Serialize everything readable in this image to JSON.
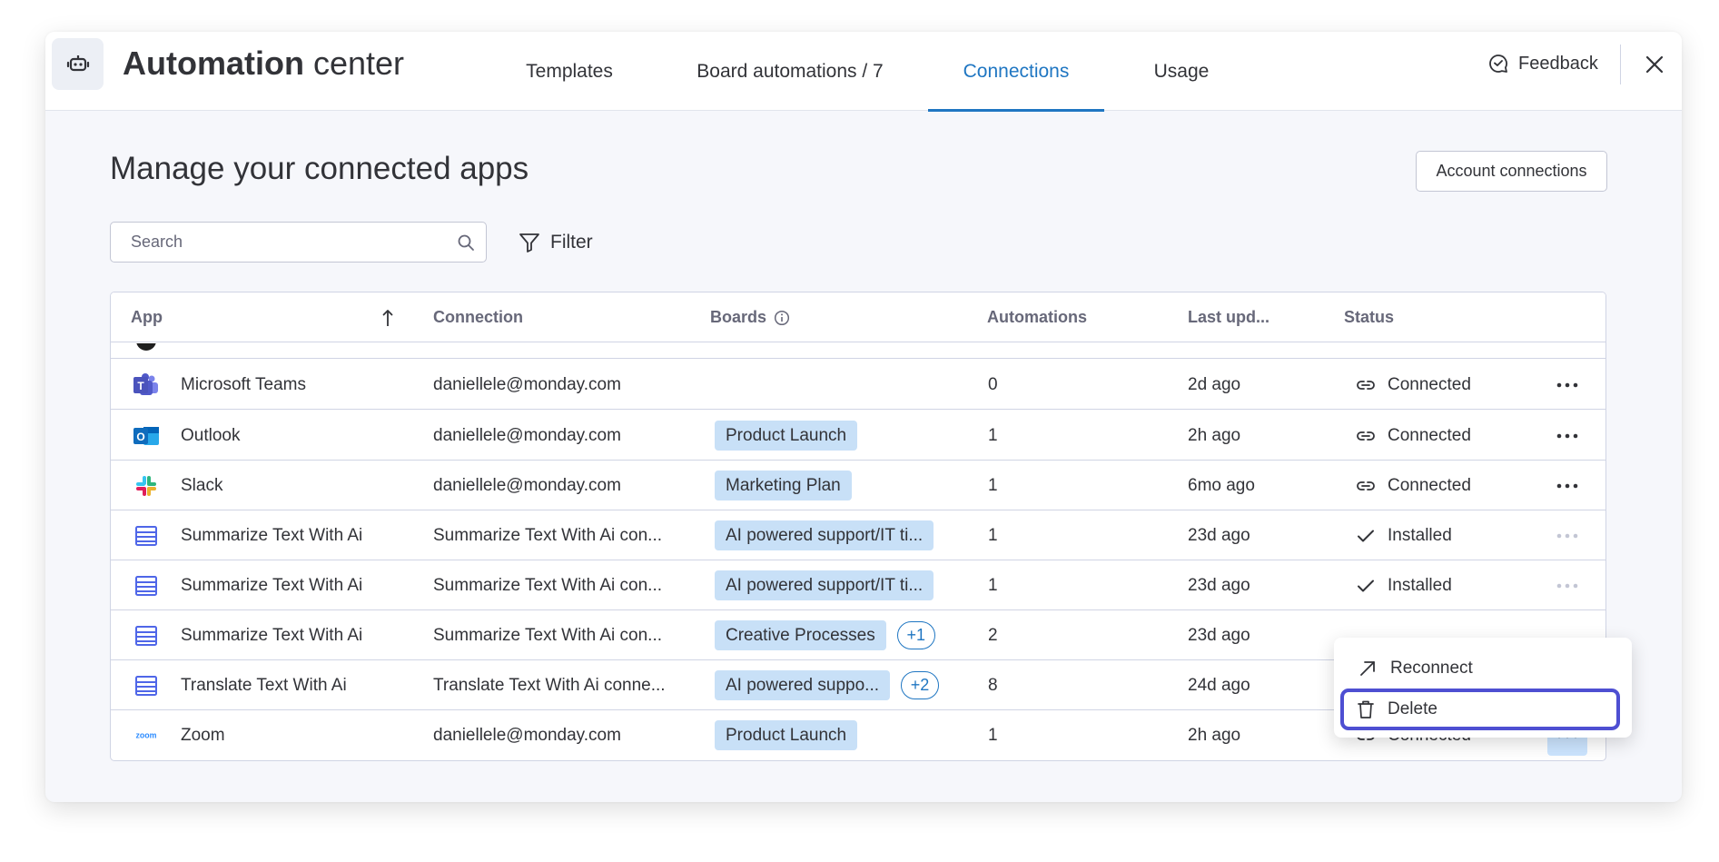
{
  "header": {
    "title_bold": "Automation",
    "title_light": " center",
    "tabs": [
      {
        "label": "Templates"
      },
      {
        "label": "Board automations / 7"
      },
      {
        "label": "Connections"
      },
      {
        "label": "Usage"
      }
    ],
    "active_tab": "Connections",
    "feedback_label": "Feedback"
  },
  "main": {
    "heading": "Manage your connected apps",
    "account_connections_label": "Account connections",
    "search_placeholder": "Search",
    "filter_label": "Filter"
  },
  "table": {
    "columns": {
      "app": "App",
      "connection": "Connection",
      "boards": "Boards",
      "automations": "Automations",
      "last_updated": "Last upd...",
      "status": "Status"
    },
    "sort": {
      "column": "App",
      "direction": "ascending"
    },
    "rows": [
      {
        "app": "Microsoft Teams",
        "icon": "microsoft-teams-icon",
        "connection": "daniellele@monday.com",
        "board": "",
        "extra_boards": "",
        "automations": "0",
        "last_updated": "2d ago",
        "status": "Connected",
        "status_icon": "link-icon"
      },
      {
        "app": "Outlook",
        "icon": "outlook-icon",
        "connection": "daniellele@monday.com",
        "board": "Product Launch",
        "extra_boards": "",
        "automations": "1",
        "last_updated": "2h ago",
        "status": "Connected",
        "status_icon": "link-icon"
      },
      {
        "app": "Slack",
        "icon": "slack-icon",
        "connection": "daniellele@monday.com",
        "board": "Marketing Plan",
        "extra_boards": "",
        "automations": "1",
        "last_updated": "6mo ago",
        "status": "Connected",
        "status_icon": "link-icon"
      },
      {
        "app": "Summarize Text With Ai",
        "icon": "ai-app-icon",
        "connection": "Summarize Text With Ai con...",
        "board": "AI powered support/IT ti...",
        "extra_boards": "",
        "automations": "1",
        "last_updated": "23d ago",
        "status": "Installed",
        "status_icon": "check-icon"
      },
      {
        "app": "Summarize Text With Ai",
        "icon": "ai-app-icon",
        "connection": "Summarize Text With Ai con...",
        "board": "AI powered support/IT ti...",
        "extra_boards": "",
        "automations": "1",
        "last_updated": "23d ago",
        "status": "Installed",
        "status_icon": "check-icon"
      },
      {
        "app": "Summarize Text With Ai",
        "icon": "ai-app-icon",
        "connection": "Summarize Text With Ai con...",
        "board": "Creative Processes",
        "extra_boards": "+1",
        "automations": "2",
        "last_updated": "23d ago",
        "status": "",
        "status_icon": ""
      },
      {
        "app": "Translate Text With Ai",
        "icon": "ai-app-icon",
        "connection": "Translate Text With Ai conne...",
        "board": "AI powered suppo...",
        "extra_boards": "+2",
        "automations": "8",
        "last_updated": "24d ago",
        "status": "",
        "status_icon": ""
      },
      {
        "app": "Zoom",
        "icon": "zoom-icon",
        "connection": "daniellele@monday.com",
        "board": "Product Launch",
        "extra_boards": "",
        "automations": "1",
        "last_updated": "2h ago",
        "status": "Connected",
        "status_icon": "link-icon"
      }
    ]
  },
  "context_menu": {
    "items": [
      {
        "label": "Reconnect",
        "icon": "arrow-up-right-icon"
      },
      {
        "label": "Delete",
        "icon": "trash-icon"
      }
    ],
    "focused_item": "Delete"
  },
  "colors": {
    "accent": "#1f76c2",
    "board_tag_bg": "#c8e0f7",
    "focus_ring": "#4e4fd2",
    "active_more_bg": "#cce5ff"
  }
}
